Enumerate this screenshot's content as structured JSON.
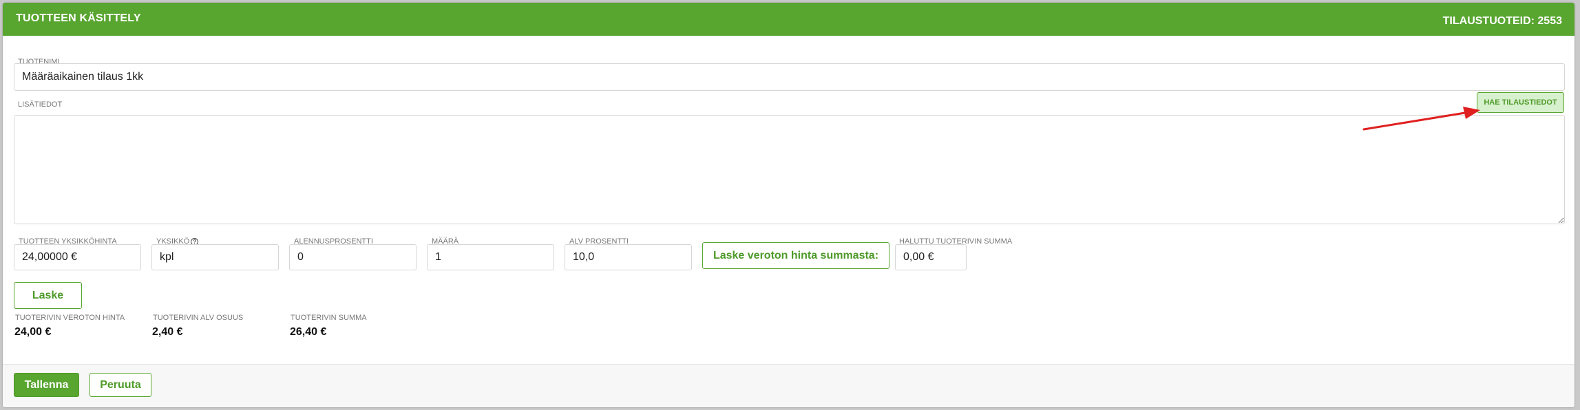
{
  "header": {
    "title": "TUOTTEEN KÄSITTELY",
    "order_id": "TILAUSTUOTEID: 2553"
  },
  "product": {
    "name_label": "TUOTENIMI",
    "name_value": "Määräaikainen tilaus 1kk",
    "info_label": "LISÄTIEDOT",
    "info_value": "",
    "fetch_button": "HAE TILAUSTIEDOT"
  },
  "pricing": {
    "unit_price_label": "TUOTTEEN YKSIKKÖHINTA",
    "unit_price_value": "24,00000 €",
    "unit_label": "YKSIKKÖ",
    "unit_value": "kpl",
    "discount_label": "ALENNUSPROSENTTI",
    "discount_value": "0",
    "quantity_label": "MÄÄRÄ",
    "quantity_value": "1",
    "vat_label": "ALV PROSENTTI",
    "vat_value": "10,0",
    "calc_from_sum_button": "Laske veroton hinta summasta:",
    "desired_sum_label": "HALUTTU TUOTERIVIN SUMMA",
    "desired_sum_value": "0,00 €",
    "calc_button": "Laske"
  },
  "results": {
    "net_label": "TUOTERIVIN VEROTON HINTA",
    "net_value": "24,00 €",
    "vat_share_label": "TUOTERIVIN ALV OSUUS",
    "vat_share_value": "2,40 €",
    "total_label": "TUOTERIVIN SUMMA",
    "total_value": "26,40 €"
  },
  "footer": {
    "save_button": "Tallenna",
    "cancel_button": "Peruuta"
  },
  "colors": {
    "brand_green": "#58a530",
    "annotation_arrow": "#e02020"
  },
  "icons": {
    "help": "question-circle-icon",
    "annotation": "red-arrow-annotation"
  }
}
